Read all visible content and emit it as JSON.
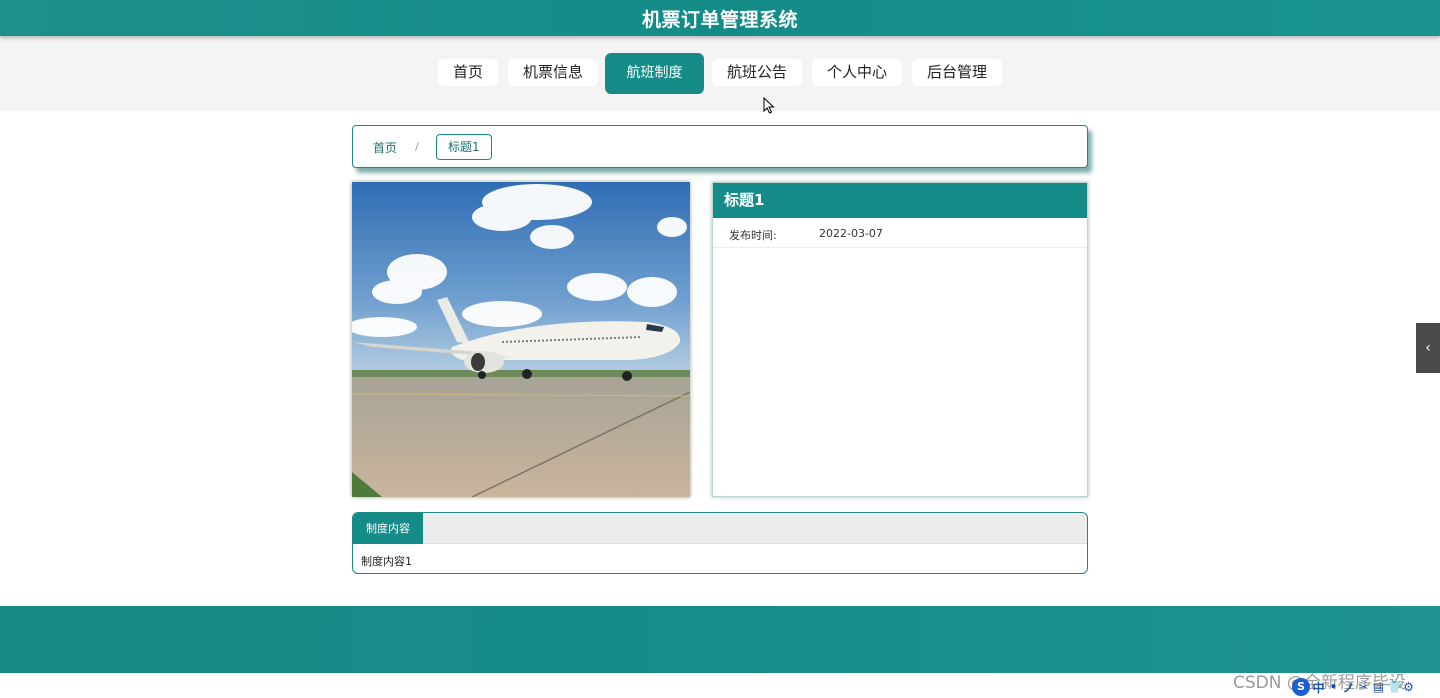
{
  "header": {
    "title": "机票订单管理系统"
  },
  "nav": {
    "items": [
      {
        "label": "首页"
      },
      {
        "label": "机票信息"
      },
      {
        "label": "航班制度"
      },
      {
        "label": "航班公告"
      },
      {
        "label": "个人中心"
      },
      {
        "label": "后台管理"
      }
    ],
    "active": "航班制度"
  },
  "breadcrumb": {
    "home": "首页",
    "separator": "/",
    "current": "标题1"
  },
  "detail": {
    "title": "标题1",
    "publish_label": "发布时间:",
    "publish_date": "2022-03-07"
  },
  "content": {
    "tab_label": "制度内容",
    "body": "制度内容1"
  },
  "side_toggle": {
    "icon": "chevron-left-icon",
    "glyph": "‹"
  },
  "watermark": "CSDN @全新程序毕设",
  "ime_toolbar": {
    "logo": "S",
    "items": [
      "中",
      "•",
      "ノ",
      "✂",
      "▤",
      "👕",
      "⚙"
    ]
  },
  "colors": {
    "accent": "#168c88",
    "nav_background": "#f4f4f4",
    "side_toggle": "#4a4a4a"
  }
}
